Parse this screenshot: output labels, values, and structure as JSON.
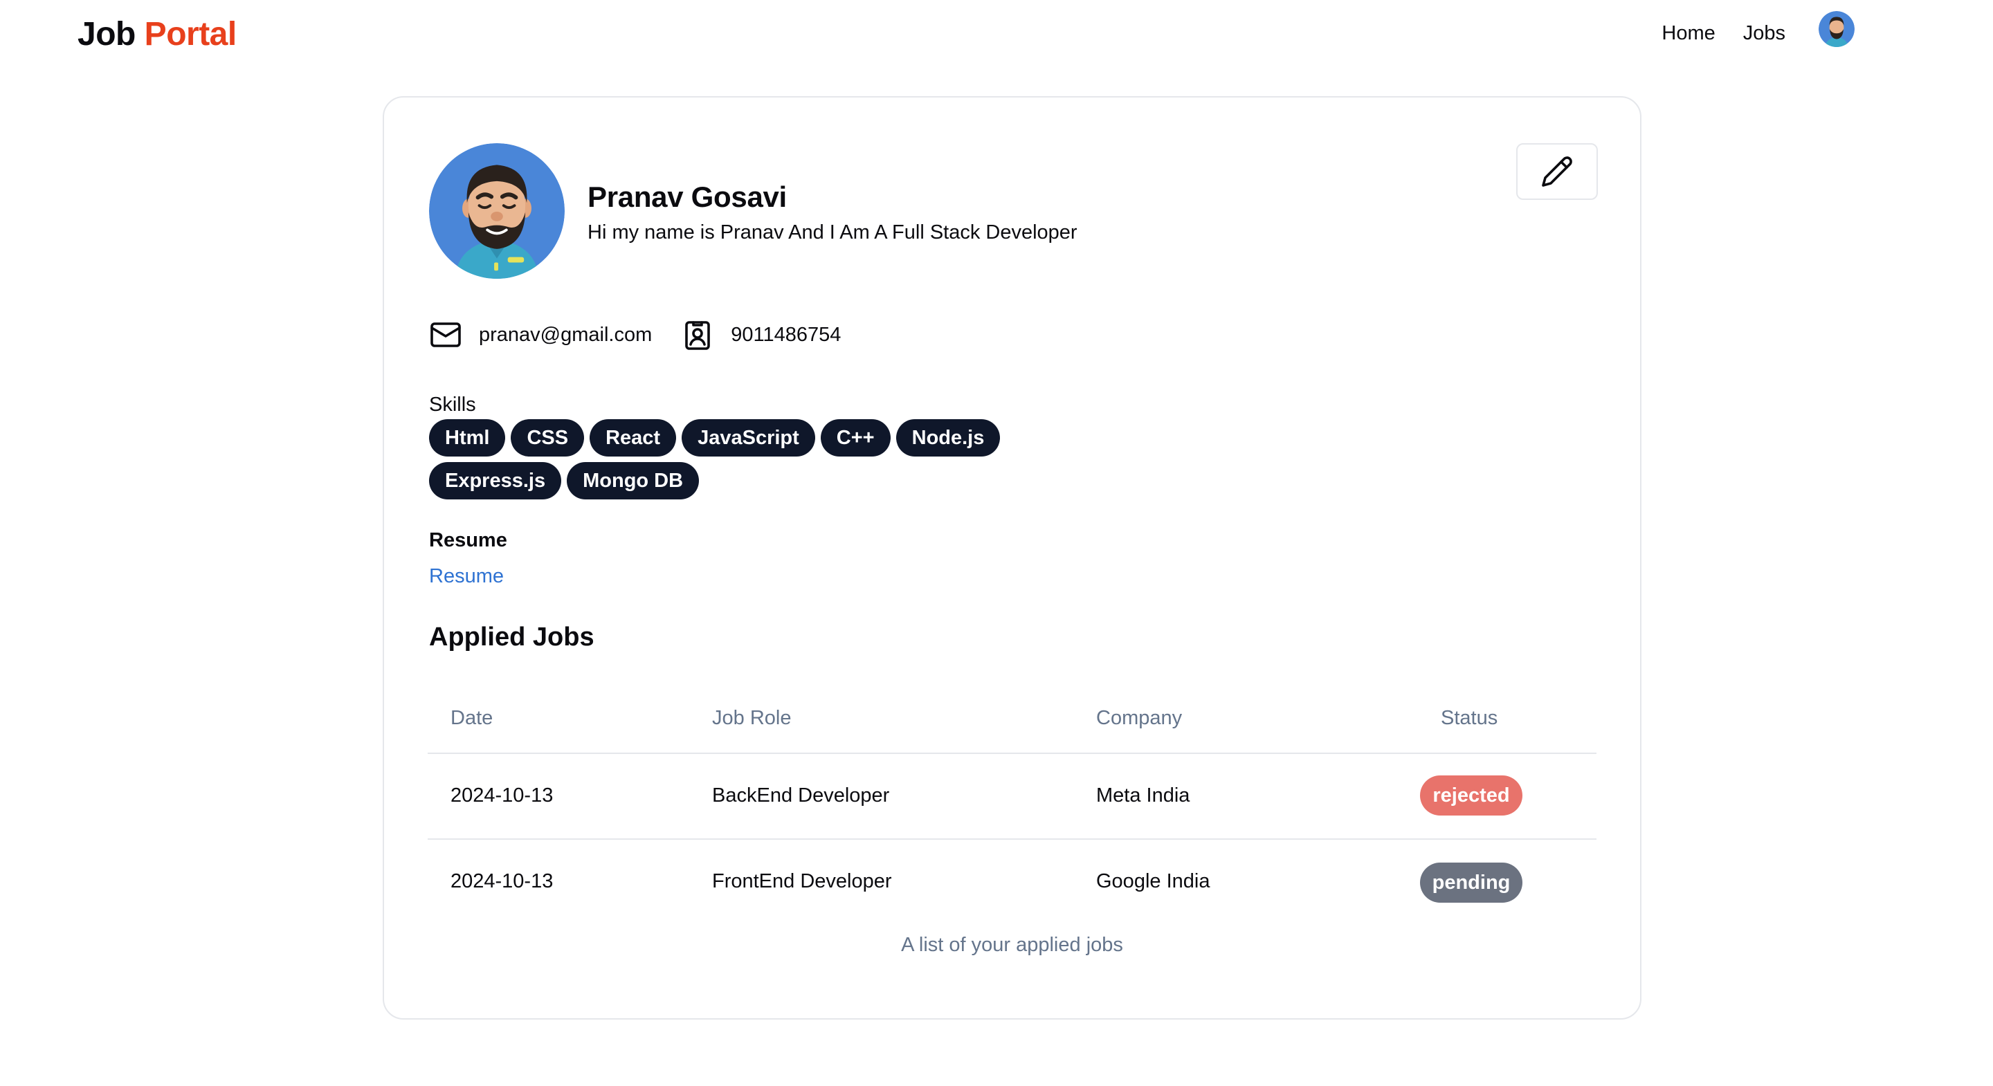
{
  "navbar": {
    "logo_main": "Job ",
    "logo_accent": "Portal",
    "links": [
      "Home",
      "Jobs"
    ],
    "avatar_icon": "user-avatar-icon"
  },
  "profile": {
    "name": "Pranav Gosavi",
    "bio": "Hi my name is Pranav And I Am A Full Stack Developer",
    "email": "pranav@gmail.com",
    "phone": "9011486754",
    "skills_label": "Skills",
    "skills": [
      "Html",
      "CSS",
      "React",
      "JavaScript",
      "C++",
      "Node.js",
      "Express.js",
      "Mongo DB"
    ],
    "resume_label": "Resume",
    "resume_link": "Resume"
  },
  "applied_jobs": {
    "title": "Applied Jobs",
    "columns": [
      "Date",
      "Job Role",
      "Company",
      "Status"
    ],
    "rows": [
      {
        "date": "2024-10-13",
        "role": "BackEnd Developer",
        "company": "Meta India",
        "status": "rejected"
      },
      {
        "date": "2024-10-13",
        "role": "FrontEnd Developer",
        "company": "Google India",
        "status": "pending"
      }
    ],
    "caption": "A list of your applied jobs"
  },
  "colors": {
    "accent": "#e8401c",
    "badge_dark": "#0f172a",
    "status_rejected": "#e8736b",
    "status_pending": "#6b7280",
    "link": "#2e72d2"
  }
}
